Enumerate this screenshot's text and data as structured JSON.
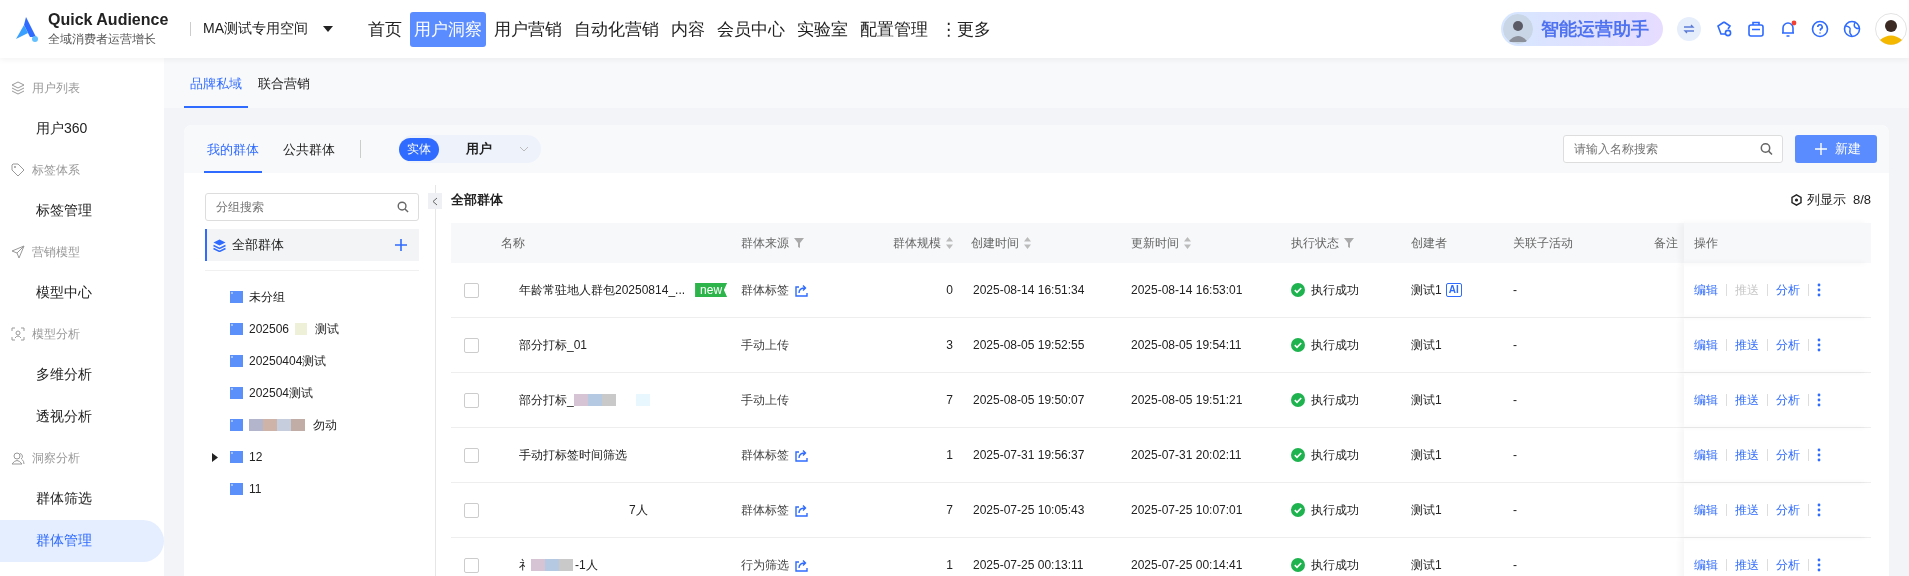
{
  "brand": {
    "name": "Quick Audience",
    "tagline": "全域消费者运营增长"
  },
  "workspace": "MA测试专用空间",
  "nav": [
    {
      "label": "首页",
      "selected": false
    },
    {
      "label": "用户洞察",
      "selected": true
    },
    {
      "label": "用户营销",
      "selected": false
    },
    {
      "label": "自动化营销",
      "selected": false
    },
    {
      "label": "内容",
      "selected": false
    },
    {
      "label": "会员中心",
      "selected": false
    },
    {
      "label": "实验室",
      "selected": false
    },
    {
      "label": "配置管理",
      "selected": false
    },
    {
      "label": "⋮更多",
      "selected": false
    }
  ],
  "assistant": "智能运营助手",
  "notifications_unread": true,
  "sidebar": [
    {
      "title": "用户列表",
      "kind": "layers",
      "items": [
        {
          "label": "用户360",
          "selected": false
        }
      ]
    },
    {
      "title": "标签体系",
      "kind": "tag",
      "items": [
        {
          "label": "标签管理",
          "selected": false
        }
      ]
    },
    {
      "title": "营销模型",
      "kind": "send",
      "items": [
        {
          "label": "模型中心",
          "selected": false
        }
      ]
    },
    {
      "title": "模型分析",
      "kind": "scan",
      "items": [
        {
          "label": "多维分析",
          "selected": false
        },
        {
          "label": "透视分析",
          "selected": false
        }
      ]
    },
    {
      "title": "洞察分析",
      "kind": "users",
      "items": [
        {
          "label": "群体筛选",
          "selected": false
        },
        {
          "label": "群体管理",
          "selected": true
        }
      ]
    }
  ],
  "subtabs": [
    {
      "label": "品牌私域",
      "selected": true
    },
    {
      "label": "联合营销",
      "selected": false
    }
  ],
  "group_tabs": [
    {
      "label": "我的群体",
      "selected": true
    },
    {
      "label": "公共群体",
      "selected": false
    }
  ],
  "entity": {
    "tag": "实体",
    "value": "用户"
  },
  "search": {
    "placeholder": "请输入名称搜索"
  },
  "new_button": "新建",
  "tree": {
    "search_placeholder": "分组搜索",
    "root": "全部群体",
    "items": [
      {
        "text": "未分组",
        "kind": "plain",
        "expandable": false
      },
      {
        "text": "202506",
        "kind": "redacted_inside",
        "text_after": "测试",
        "expandable": false
      },
      {
        "text": "20250404测试",
        "kind": "plain",
        "expandable": false
      },
      {
        "text": "202504测试",
        "kind": "plain",
        "expandable": false
      },
      {
        "text": "勿动",
        "kind": "redacted_before",
        "expandable": false
      },
      {
        "text": "12",
        "kind": "plain",
        "expandable": true
      },
      {
        "text": "11",
        "kind": "plain",
        "expandable": false
      }
    ]
  },
  "table_title": "全部群体",
  "columns_display": {
    "label": "列显示",
    "count": "8/8"
  },
  "columns": [
    {
      "label": "名称",
      "kind": "plain"
    },
    {
      "label": "群体来源",
      "kind": "filter"
    },
    {
      "label": "群体规模",
      "kind": "sort"
    },
    {
      "label": "创建时间",
      "kind": "sort"
    },
    {
      "label": "更新时间",
      "kind": "sort"
    },
    {
      "label": "执行状态",
      "kind": "filter"
    },
    {
      "label": "创建者",
      "kind": "plain"
    },
    {
      "label": "关联子活动",
      "kind": "plain"
    },
    {
      "label": "备注",
      "kind": "plain"
    },
    {
      "label": "操作",
      "kind": "plain"
    }
  ],
  "rows": [
    {
      "checked": false,
      "name": "年龄常驻地人群包20250814_...",
      "kind": "plain",
      "new": true,
      "new_label": "new",
      "source": "群体标签",
      "linked": true,
      "size": "0",
      "created": "2025-08-14 16:51:34",
      "updated": "2025-08-14 16:53:01",
      "status": {
        "text": "执行成功",
        "kind": "success"
      },
      "creator": "测试1",
      "ai": true,
      "ai_label": "AI",
      "activity": "-",
      "actions": [
        {
          "label": "编辑",
          "disabled": false
        },
        {
          "label": "推送",
          "disabled": true
        },
        {
          "label": "分析",
          "disabled": false
        }
      ]
    },
    {
      "checked": false,
      "name": "部分打标_01",
      "kind": "plain",
      "new": false,
      "source": "手动上传",
      "linked": false,
      "size": "3",
      "created": "2025-08-05 19:52:55",
      "updated": "2025-08-05 19:54:11",
      "status": {
        "text": "执行成功",
        "kind": "success"
      },
      "creator": "测试1",
      "ai": false,
      "activity": "-",
      "actions": [
        {
          "label": "编辑",
          "disabled": false
        },
        {
          "label": "推送",
          "disabled": false
        },
        {
          "label": "分析",
          "disabled": false
        }
      ]
    },
    {
      "checked": false,
      "name": "部分打标_",
      "kind": "redacted_after",
      "new": false,
      "source": "手动上传",
      "linked": false,
      "size": "7",
      "created": "2025-08-05 19:50:07",
      "updated": "2025-08-05 19:51:21",
      "status": {
        "text": "执行成功",
        "kind": "success"
      },
      "creator": "测试1",
      "ai": false,
      "activity": "-",
      "actions": [
        {
          "label": "编辑",
          "disabled": false
        },
        {
          "label": "推送",
          "disabled": false
        },
        {
          "label": "分析",
          "disabled": false
        }
      ]
    },
    {
      "checked": false,
      "name": "手动打标签时间筛选",
      "kind": "plain",
      "new": false,
      "source": "群体标签",
      "linked": true,
      "size": "1",
      "created": "2025-07-31 19:56:37",
      "updated": "2025-07-31 20:02:11",
      "status": {
        "text": "执行成功",
        "kind": "success"
      },
      "creator": "测试1",
      "ai": false,
      "activity": "-",
      "actions": [
        {
          "label": "编辑",
          "disabled": false
        },
        {
          "label": "推送",
          "disabled": false
        },
        {
          "label": "分析",
          "disabled": false
        }
      ]
    },
    {
      "checked": false,
      "name": "7人",
      "kind": "blank_before",
      "new": false,
      "source": "群体标签",
      "linked": true,
      "size": "7",
      "created": "2025-07-25 10:05:43",
      "updated": "2025-07-25 10:07:01",
      "status": {
        "text": "执行成功",
        "kind": "success"
      },
      "creator": "测试1",
      "ai": false,
      "activity": "-",
      "actions": [
        {
          "label": "编辑",
          "disabled": false
        },
        {
          "label": "推送",
          "disabled": false
        },
        {
          "label": "分析",
          "disabled": false
        }
      ]
    },
    {
      "checked": false,
      "name": "礻",
      "kind": "redacted_inside",
      "name_after": "-1人",
      "new": false,
      "source": "行为筛选",
      "linked": true,
      "size": "1",
      "created": "2025-07-25 00:13:11",
      "updated": "2025-07-25 00:14:41",
      "status": {
        "text": "执行成功",
        "kind": "success"
      },
      "creator": "测试1",
      "ai": false,
      "activity": "-",
      "actions": [
        {
          "label": "编辑",
          "disabled": false
        },
        {
          "label": "推送",
          "disabled": false
        },
        {
          "label": "分析",
          "disabled": false
        }
      ]
    }
  ]
}
